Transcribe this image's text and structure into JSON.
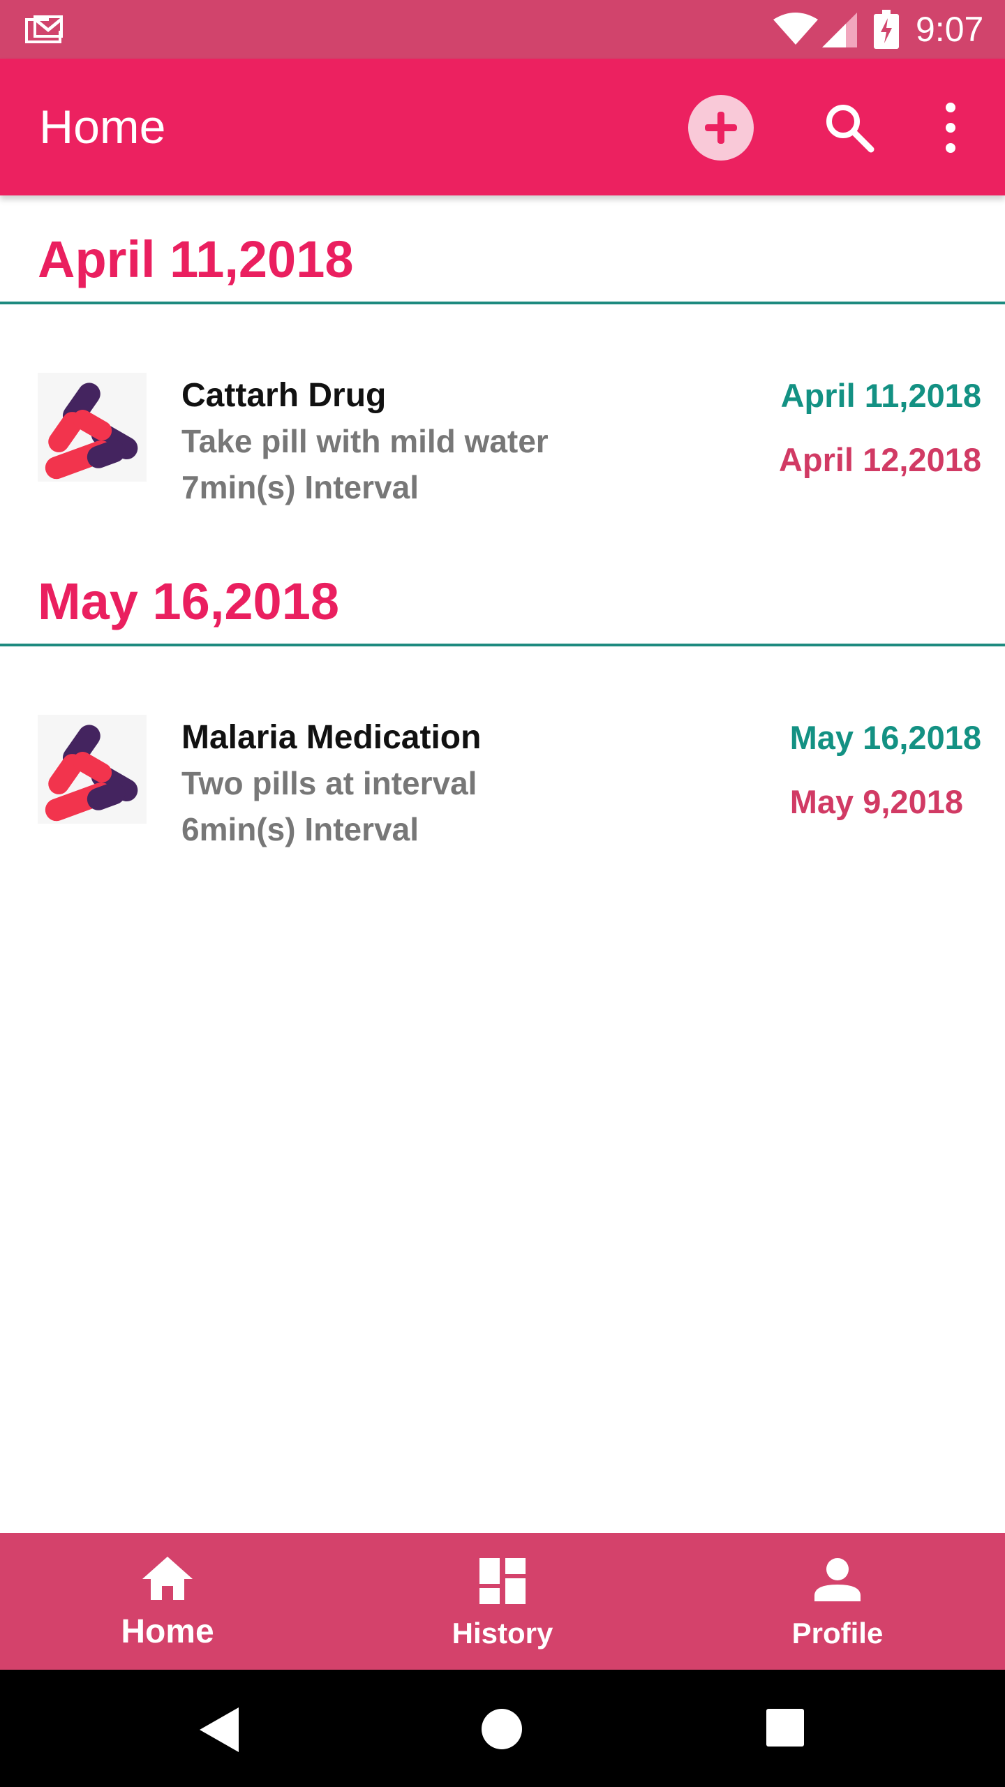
{
  "status_bar": {
    "time": "9:07",
    "icons": [
      "gmail-notification-icon",
      "wifi-icon",
      "cell-signal-icon",
      "battery-charging-icon"
    ]
  },
  "app_bar": {
    "title": "Home",
    "actions": [
      "add-icon",
      "search-icon",
      "more-vert-icon"
    ]
  },
  "sections": [
    {
      "date": "April 11,2018",
      "items": [
        {
          "name": "Cattarh Drug",
          "description": "Take pill with mild water",
          "interval": "7min(s) Interval",
          "start_date": "April 11,2018",
          "end_date": "April 12,2018"
        }
      ]
    },
    {
      "date": "May 16,2018",
      "items": [
        {
          "name": "Malaria Medication",
          "description": "Two pills at interval",
          "interval": "6min(s) Interval",
          "start_date": "May 16,2018",
          "end_date": "May 9,2018"
        }
      ]
    }
  ],
  "bottom_nav": {
    "items": [
      {
        "label": "Home",
        "icon": "home-icon",
        "active": true
      },
      {
        "label": "History",
        "icon": "dashboard-icon",
        "active": false
      },
      {
        "label": "Profile",
        "icon": "person-icon",
        "active": false
      }
    ]
  },
  "colors": {
    "status_bar": "#d1446c",
    "app_bar": "#ec2160",
    "section_date": "#ea1f5f",
    "divider": "#1d8a7f",
    "start_date": "#139183",
    "end_date": "#d13a64",
    "bottom_nav": "#d4426b"
  }
}
